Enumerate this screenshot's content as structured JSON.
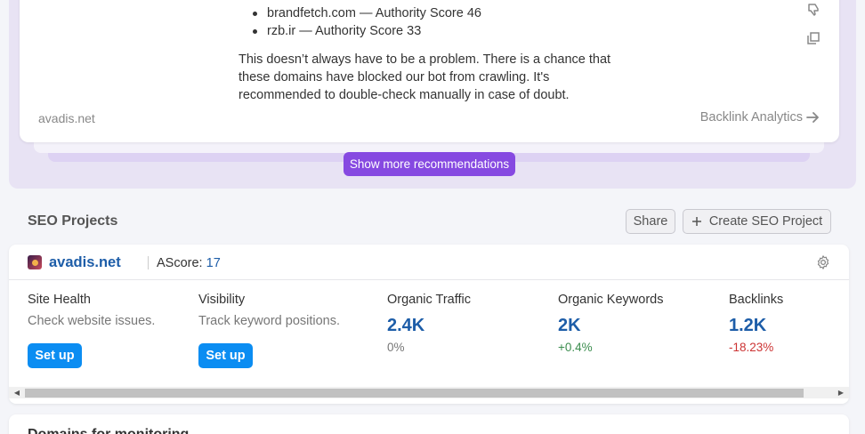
{
  "recommendation": {
    "list": [
      "brandfetch.com — Authority Score 46",
      "rzb.ir — Authority Score 33"
    ],
    "text": "This doesn’t always have to be a problem. There is a chance that these domains have blocked our bot from crawling. It's recommended to double-check manually in case of doubt.",
    "site": "avadis.net",
    "link_label": "Backlink Analytics",
    "show_more_label": "Show more recommendations"
  },
  "seo_projects": {
    "title": "SEO Projects",
    "share_label": "Share",
    "create_label": "Create SEO Project"
  },
  "project": {
    "name": "avadis.net",
    "ascore_label": "AScore:",
    "ascore_value": "17",
    "site_health": {
      "label": "Site Health",
      "sub": "Check website issues.",
      "button": "Set up"
    },
    "visibility": {
      "label": "Visibility",
      "sub": "Track keyword positions.",
      "button": "Set up"
    },
    "organic_traffic": {
      "label": "Organic Traffic",
      "value": "2.4K",
      "change": "0%"
    },
    "organic_keywords": {
      "label": "Organic Keywords",
      "value": "2K",
      "change": "+0.4%"
    },
    "backlinks": {
      "label": "Backlinks",
      "value": "1.2K",
      "change": "-18.23%"
    }
  },
  "next_section": {
    "title": "Domains for monitoring"
  },
  "colors": {
    "accent_purple": "#8649e1",
    "primary_blue": "#0b8df2",
    "link_blue": "#1d5da8",
    "positive": "#3c8d4f",
    "negative": "#cc3333"
  },
  "icons": [
    "thumbs-down-icon",
    "copy-icon",
    "arrow-right-icon",
    "plus-icon",
    "gear-icon",
    "site-favicon"
  ]
}
